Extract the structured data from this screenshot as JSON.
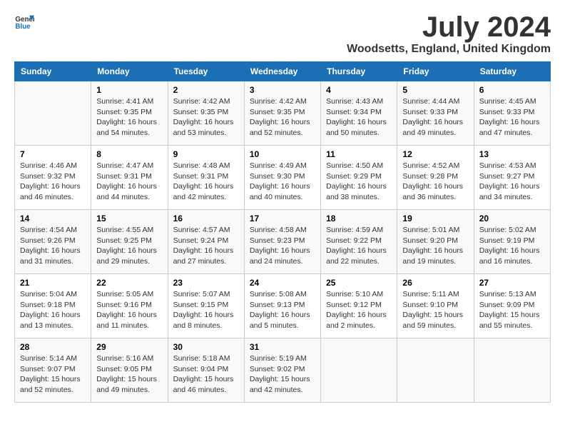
{
  "header": {
    "logo_general": "General",
    "logo_blue": "Blue",
    "month_title": "July 2024",
    "location": "Woodsetts, England, United Kingdom"
  },
  "weekdays": [
    "Sunday",
    "Monday",
    "Tuesday",
    "Wednesday",
    "Thursday",
    "Friday",
    "Saturday"
  ],
  "weeks": [
    [
      {
        "day": "",
        "sunrise": "",
        "sunset": "",
        "daylight": ""
      },
      {
        "day": "1",
        "sunrise": "Sunrise: 4:41 AM",
        "sunset": "Sunset: 9:35 PM",
        "daylight": "Daylight: 16 hours and 54 minutes."
      },
      {
        "day": "2",
        "sunrise": "Sunrise: 4:42 AM",
        "sunset": "Sunset: 9:35 PM",
        "daylight": "Daylight: 16 hours and 53 minutes."
      },
      {
        "day": "3",
        "sunrise": "Sunrise: 4:42 AM",
        "sunset": "Sunset: 9:35 PM",
        "daylight": "Daylight: 16 hours and 52 minutes."
      },
      {
        "day": "4",
        "sunrise": "Sunrise: 4:43 AM",
        "sunset": "Sunset: 9:34 PM",
        "daylight": "Daylight: 16 hours and 50 minutes."
      },
      {
        "day": "5",
        "sunrise": "Sunrise: 4:44 AM",
        "sunset": "Sunset: 9:33 PM",
        "daylight": "Daylight: 16 hours and 49 minutes."
      },
      {
        "day": "6",
        "sunrise": "Sunrise: 4:45 AM",
        "sunset": "Sunset: 9:33 PM",
        "daylight": "Daylight: 16 hours and 47 minutes."
      }
    ],
    [
      {
        "day": "7",
        "sunrise": "Sunrise: 4:46 AM",
        "sunset": "Sunset: 9:32 PM",
        "daylight": "Daylight: 16 hours and 46 minutes."
      },
      {
        "day": "8",
        "sunrise": "Sunrise: 4:47 AM",
        "sunset": "Sunset: 9:31 PM",
        "daylight": "Daylight: 16 hours and 44 minutes."
      },
      {
        "day": "9",
        "sunrise": "Sunrise: 4:48 AM",
        "sunset": "Sunset: 9:31 PM",
        "daylight": "Daylight: 16 hours and 42 minutes."
      },
      {
        "day": "10",
        "sunrise": "Sunrise: 4:49 AM",
        "sunset": "Sunset: 9:30 PM",
        "daylight": "Daylight: 16 hours and 40 minutes."
      },
      {
        "day": "11",
        "sunrise": "Sunrise: 4:50 AM",
        "sunset": "Sunset: 9:29 PM",
        "daylight": "Daylight: 16 hours and 38 minutes."
      },
      {
        "day": "12",
        "sunrise": "Sunrise: 4:52 AM",
        "sunset": "Sunset: 9:28 PM",
        "daylight": "Daylight: 16 hours and 36 minutes."
      },
      {
        "day": "13",
        "sunrise": "Sunrise: 4:53 AM",
        "sunset": "Sunset: 9:27 PM",
        "daylight": "Daylight: 16 hours and 34 minutes."
      }
    ],
    [
      {
        "day": "14",
        "sunrise": "Sunrise: 4:54 AM",
        "sunset": "Sunset: 9:26 PM",
        "daylight": "Daylight: 16 hours and 31 minutes."
      },
      {
        "day": "15",
        "sunrise": "Sunrise: 4:55 AM",
        "sunset": "Sunset: 9:25 PM",
        "daylight": "Daylight: 16 hours and 29 minutes."
      },
      {
        "day": "16",
        "sunrise": "Sunrise: 4:57 AM",
        "sunset": "Sunset: 9:24 PM",
        "daylight": "Daylight: 16 hours and 27 minutes."
      },
      {
        "day": "17",
        "sunrise": "Sunrise: 4:58 AM",
        "sunset": "Sunset: 9:23 PM",
        "daylight": "Daylight: 16 hours and 24 minutes."
      },
      {
        "day": "18",
        "sunrise": "Sunrise: 4:59 AM",
        "sunset": "Sunset: 9:22 PM",
        "daylight": "Daylight: 16 hours and 22 minutes."
      },
      {
        "day": "19",
        "sunrise": "Sunrise: 5:01 AM",
        "sunset": "Sunset: 9:20 PM",
        "daylight": "Daylight: 16 hours and 19 minutes."
      },
      {
        "day": "20",
        "sunrise": "Sunrise: 5:02 AM",
        "sunset": "Sunset: 9:19 PM",
        "daylight": "Daylight: 16 hours and 16 minutes."
      }
    ],
    [
      {
        "day": "21",
        "sunrise": "Sunrise: 5:04 AM",
        "sunset": "Sunset: 9:18 PM",
        "daylight": "Daylight: 16 hours and 13 minutes."
      },
      {
        "day": "22",
        "sunrise": "Sunrise: 5:05 AM",
        "sunset": "Sunset: 9:16 PM",
        "daylight": "Daylight: 16 hours and 11 minutes."
      },
      {
        "day": "23",
        "sunrise": "Sunrise: 5:07 AM",
        "sunset": "Sunset: 9:15 PM",
        "daylight": "Daylight: 16 hours and 8 minutes."
      },
      {
        "day": "24",
        "sunrise": "Sunrise: 5:08 AM",
        "sunset": "Sunset: 9:13 PM",
        "daylight": "Daylight: 16 hours and 5 minutes."
      },
      {
        "day": "25",
        "sunrise": "Sunrise: 5:10 AM",
        "sunset": "Sunset: 9:12 PM",
        "daylight": "Daylight: 16 hours and 2 minutes."
      },
      {
        "day": "26",
        "sunrise": "Sunrise: 5:11 AM",
        "sunset": "Sunset: 9:10 PM",
        "daylight": "Daylight: 15 hours and 59 minutes."
      },
      {
        "day": "27",
        "sunrise": "Sunrise: 5:13 AM",
        "sunset": "Sunset: 9:09 PM",
        "daylight": "Daylight: 15 hours and 55 minutes."
      }
    ],
    [
      {
        "day": "28",
        "sunrise": "Sunrise: 5:14 AM",
        "sunset": "Sunset: 9:07 PM",
        "daylight": "Daylight: 15 hours and 52 minutes."
      },
      {
        "day": "29",
        "sunrise": "Sunrise: 5:16 AM",
        "sunset": "Sunset: 9:05 PM",
        "daylight": "Daylight: 15 hours and 49 minutes."
      },
      {
        "day": "30",
        "sunrise": "Sunrise: 5:18 AM",
        "sunset": "Sunset: 9:04 PM",
        "daylight": "Daylight: 15 hours and 46 minutes."
      },
      {
        "day": "31",
        "sunrise": "Sunrise: 5:19 AM",
        "sunset": "Sunset: 9:02 PM",
        "daylight": "Daylight: 15 hours and 42 minutes."
      },
      {
        "day": "",
        "sunrise": "",
        "sunset": "",
        "daylight": ""
      },
      {
        "day": "",
        "sunrise": "",
        "sunset": "",
        "daylight": ""
      },
      {
        "day": "",
        "sunrise": "",
        "sunset": "",
        "daylight": ""
      }
    ]
  ]
}
